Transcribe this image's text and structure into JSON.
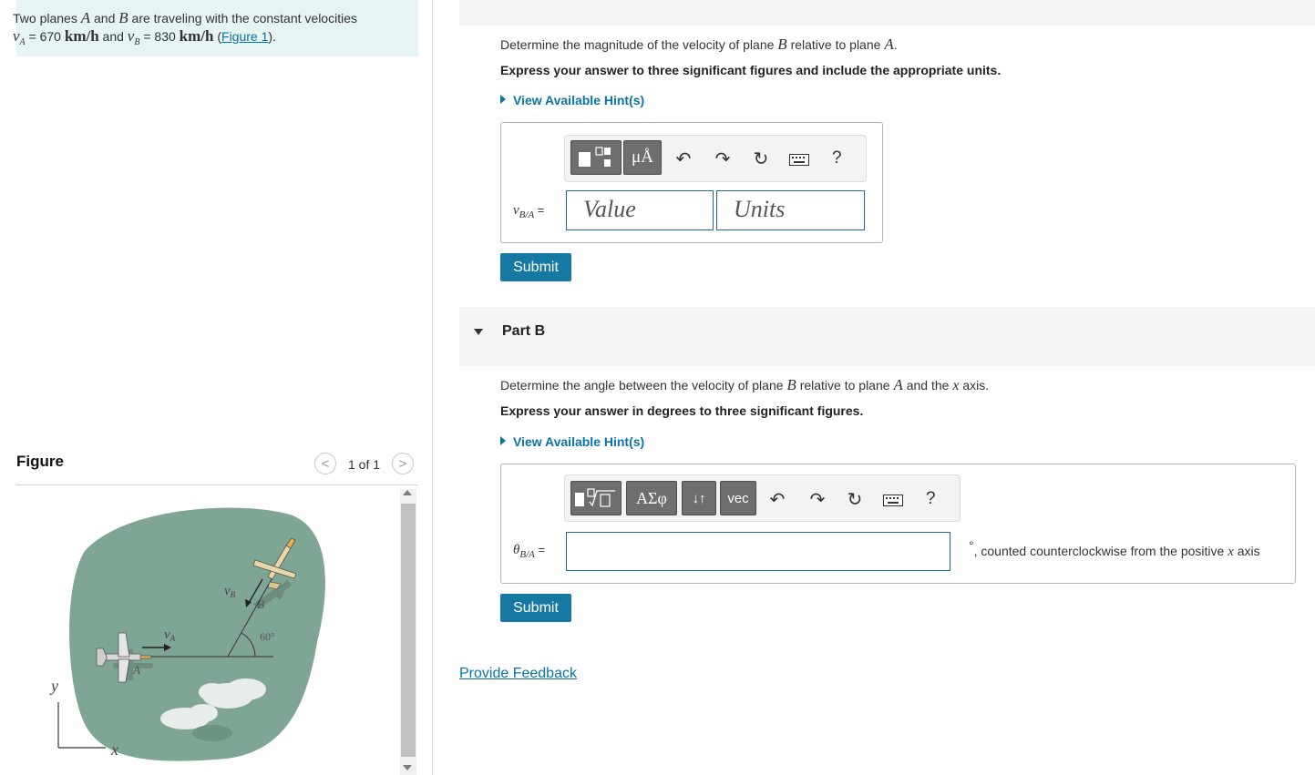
{
  "problem": {
    "line1_prefix": "Two planes ",
    "planeA": "A",
    "and": " and ",
    "planeB": "B",
    "line1_suffix": " are traveling with the constant velocities",
    "vA_symbol": "v",
    "vA_sub": "A",
    "eq1": " = 670 ",
    "unit1": "km/h",
    "and2": " and ",
    "vB_symbol": "v",
    "vB_sub": "B",
    "eq2": " = 830 ",
    "unit2": "km/h",
    "figure_open": " (",
    "figure_link": "Figure 1",
    "figure_close": ")."
  },
  "figure_panel": {
    "title": "Figure",
    "count": "1 of 1",
    "prev": "<",
    "next": ">",
    "labels": {
      "vB": "v",
      "vB_sub": "B",
      "vA": "v",
      "vA_sub": "A",
      "B": "B",
      "A": "A",
      "angle": "60°",
      "y": "y",
      "x": "x"
    }
  },
  "partA": {
    "question_prefix": "Determine the magnitude of the velocity of plane ",
    "B": "B",
    "question_mid": " relative to plane ",
    "A": "A",
    "question_suffix": ".",
    "instruction": "Express your answer to three significant figures and include the appropriate units.",
    "hint": "View Available Hint(s)",
    "toolbar": {
      "units_btn": "μÅ",
      "help": "?"
    },
    "label": "v",
    "label_sub": "B/A",
    "label_eq": " =",
    "value_placeholder": "Value",
    "units_placeholder": "Units",
    "submit": "Submit"
  },
  "partB": {
    "title": "Part B",
    "question_prefix": "Determine the angle between the velocity of plane ",
    "B": "B",
    "question_mid": " relative to plane ",
    "A": "A",
    "question_mid2": " and the ",
    "x": "x",
    "question_suffix": " axis.",
    "instruction": "Express your answer in degrees to three significant figures.",
    "hint": "View Available Hint(s)",
    "toolbar": {
      "greek": "ΑΣφ",
      "swap": "↓↑",
      "vec": "vec",
      "help": "?"
    },
    "label": "θ",
    "label_sub": "B/A",
    "label_eq": " =",
    "unit_degree": "°",
    "unit_suffix": ", counted counterclockwise from the positive ",
    "unit_x": "x",
    "unit_end": " axis",
    "submit": "Submit"
  },
  "feedback": "Provide Feedback"
}
